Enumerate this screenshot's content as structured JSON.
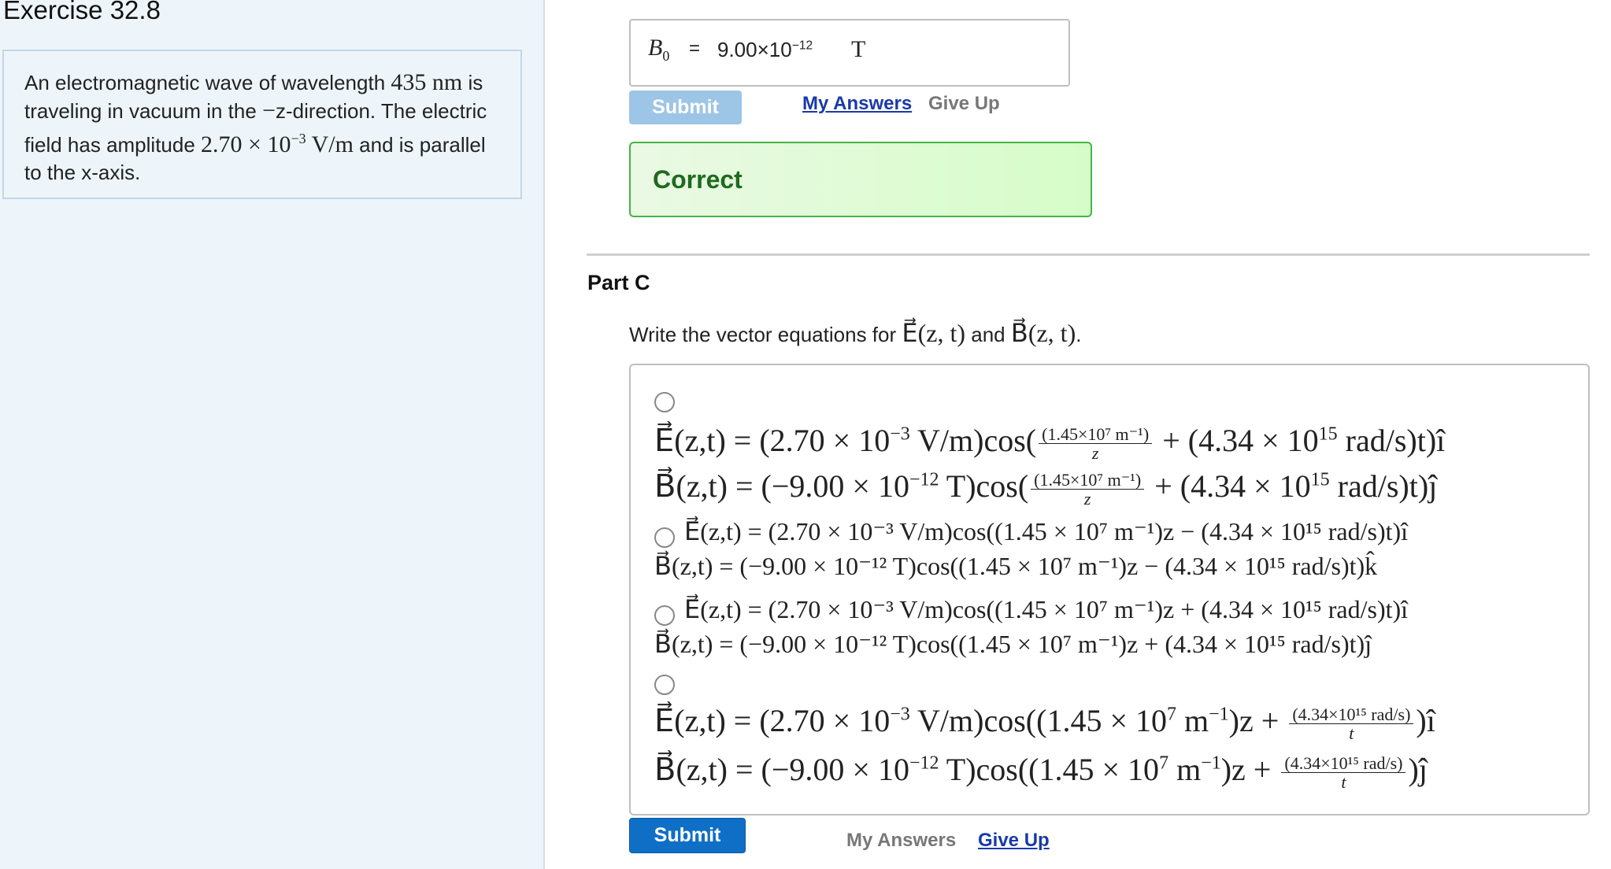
{
  "exercise": {
    "title": "Exercise 32.8",
    "problem": {
      "p1": "An electromagnetic wave of wavelength",
      "m1": "435 nm",
      "p2": "is traveling in vacuum in the",
      "m2": "−",
      "p3": "z-direction. The electric field has amplitude",
      "m3": "2.70 × 10",
      "m3_exp": "−3",
      "m3_unit": "V/m",
      "p4": "and is parallel to the x-axis."
    }
  },
  "part_b": {
    "label": "B",
    "label_sub": "0",
    "equals": "=",
    "value": "9.00×10",
    "value_exp": "−12",
    "unit": "T",
    "submit_label": "Submit",
    "my_answers_label": "My Answers",
    "give_up_label": "Give Up",
    "feedback": "Correct"
  },
  "part_c": {
    "title": "Part C",
    "prompt_pre": "Write the vector equations for",
    "prompt_e": "E⃗(z, t)",
    "prompt_and": "and",
    "prompt_b": "B⃗(z, t)",
    "prompt_end": ".",
    "options": [
      {
        "e_pre": "E⃗(z,t) = (2.70 × 10",
        "e_exp": "−3",
        "e_mid": " V/m)cos(",
        "e_frac_num": "(1.45×10⁷ m⁻¹)",
        "e_frac_den": "z",
        "e_post": " + (4.34 × 10",
        "e_exp2": "15",
        "e_end": " rad/s)t)î",
        "b_pre": "B⃗(z,t) = (−9.00 × 10",
        "b_exp": "−12",
        "b_mid": " T)cos(",
        "b_frac_num": "(1.45×10⁷ m⁻¹)",
        "b_frac_den": "z",
        "b_post": " + (4.34 × 10",
        "b_exp2": "15",
        "b_end": " rad/s)t)ĵ"
      },
      {
        "e_line": "E⃗(z,t) = (2.70 × 10⁻³ V/m)cos((1.45 × 10⁷ m⁻¹)z − (4.34 × 10¹⁵ rad/s)t)î",
        "b_line": "B⃗(z,t) = (−9.00 × 10⁻¹² T)cos((1.45 × 10⁷ m⁻¹)z − (4.34 × 10¹⁵ rad/s)t)k̂"
      },
      {
        "e_line": "E⃗(z,t) = (2.70 × 10⁻³ V/m)cos((1.45 × 10⁷ m⁻¹)z + (4.34 × 10¹⁵ rad/s)t)î",
        "b_line": "B⃗(z,t) = (−9.00 × 10⁻¹² T)cos((1.45 × 10⁷ m⁻¹)z + (4.34 × 10¹⁵ rad/s)t)ĵ"
      },
      {
        "e_pre": "E⃗(z,t) = (2.70 × 10",
        "e_exp": "−3",
        "e_mid": " V/m)cos((1.45 × 10",
        "e_exp2": "7",
        "e_mid2": " m",
        "e_exp3": "−1",
        "e_post": ")z + ",
        "e_frac_num": "(4.34×10¹⁵ rad/s)",
        "e_frac_den": "t",
        "e_end": ")î",
        "b_pre": "B⃗(z,t) = (−9.00 × 10",
        "b_exp": "−12",
        "b_mid": " T)cos((1.45 × 10",
        "b_exp2": "7",
        "b_mid2": " m",
        "b_exp3": "−1",
        "b_post": ")z + ",
        "b_frac_num": "(4.34×10¹⁵ rad/s)",
        "b_frac_den": "t",
        "b_end": ")ĵ"
      }
    ],
    "submit_label": "Submit",
    "my_answers_label": "My Answers",
    "give_up_label": "Give Up"
  }
}
